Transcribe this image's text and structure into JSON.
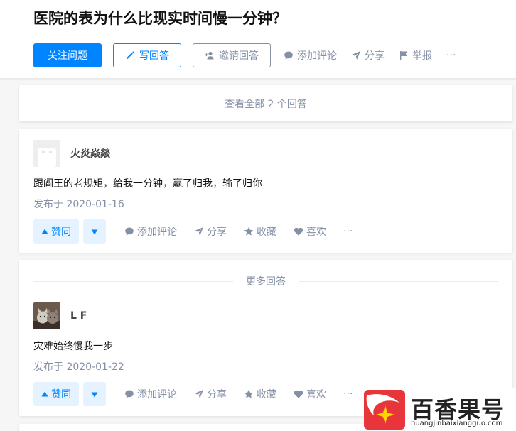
{
  "question": {
    "title": "医院的表为什么比现实时间慢一分钟？",
    "follow_label": "关注问题",
    "write_label": "写回答",
    "invite_label": "邀请回答",
    "comment_label": "添加评论",
    "share_label": "分享",
    "report_label": "举报",
    "more_label": "···"
  },
  "view_all": "查看全部 2 个回答",
  "more_answers": "更多回答",
  "answers": [
    {
      "author": "火炎焱燚",
      "content": "跟阎王的老规矩，给我一分钟，赢了归我，输了归你",
      "date": "发布于 2020-01-16",
      "vote_label": "赞同",
      "comment_label": "添加评论",
      "share_label": "分享",
      "collect_label": "收藏",
      "like_label": "喜欢",
      "more_label": "···"
    },
    {
      "author": "L F",
      "content": "灾难始终慢我一步",
      "date": "发布于 2020-01-22",
      "vote_label": "赞同",
      "comment_label": "添加评论",
      "share_label": "分享",
      "collect_label": "收藏",
      "like_label": "喜欢",
      "more_label": "···"
    }
  ],
  "watermark": {
    "brand": "百香果号",
    "url": "huangjinbaixiangguo.com"
  },
  "colors": {
    "primary": "#0084ff",
    "muted": "#8590a6",
    "vote_bg": "#e5f2ff",
    "logo_red": "#e8353b"
  }
}
